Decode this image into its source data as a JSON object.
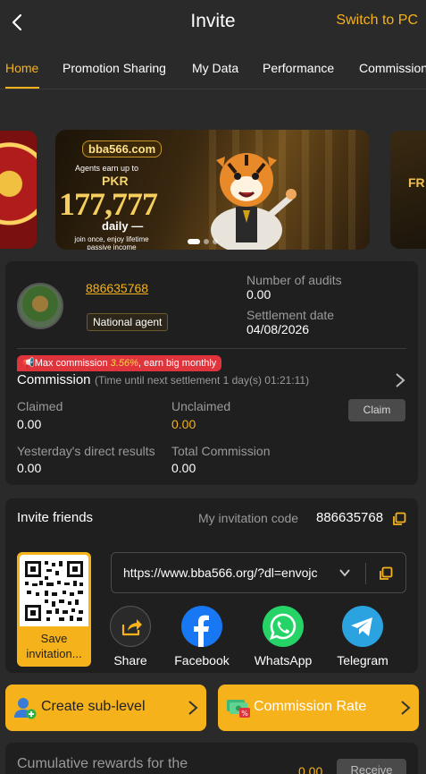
{
  "header": {
    "title": "Invite",
    "switch_label": "Switch to PC"
  },
  "tabs": [
    {
      "label": "Home",
      "active": true
    },
    {
      "label": "Promotion Sharing"
    },
    {
      "label": "My Data"
    },
    {
      "label": "Performance"
    },
    {
      "label": "Commission"
    }
  ],
  "banner": {
    "logo": "bba566.com",
    "subtitle": "Agents earn up to",
    "currency": "PKR",
    "amount": "177,777",
    "period": "daily —",
    "tagline": "join once, enjoy lifetime passive income",
    "right_peek": "FR"
  },
  "agent": {
    "user_id": "886635768",
    "badge": "National agent",
    "audits_label": "Number of audits",
    "audits_value": "0.00",
    "settlement_label": "Settlement date",
    "settlement_value": "04/08/2026"
  },
  "commission": {
    "promo_prefix": "Max commission ",
    "promo_pct": "3.56%",
    "promo_suffix": ", earn big monthly",
    "title": "Commission",
    "timer": "(Time until next settlement  1 day(s) 01:21:11)",
    "claimed_label": "Claimed",
    "claimed_value": "0.00",
    "unclaimed_label": "Unclaimed",
    "unclaimed_value": "0.00",
    "claim_button": "Claim",
    "yesterday_label": "Yesterday's direct results",
    "yesterday_value": "0.00",
    "total_label": "Total Commission",
    "total_value": "0.00"
  },
  "invite": {
    "title": "Invite friends",
    "code_label": "My invitation code",
    "code_value": "886635768",
    "save_label": "Save invitation...",
    "link": "https://www.bba566.org/?dl=envojc",
    "share": [
      {
        "label": "Share",
        "icon": "share-icon",
        "color": "#2a2a2a"
      },
      {
        "label": "Facebook",
        "icon": "facebook-icon",
        "color": "#1877f2"
      },
      {
        "label": "WhatsApp",
        "icon": "whatsapp-icon",
        "color": "#25d366"
      },
      {
        "label": "Telegram",
        "icon": "telegram-icon",
        "color": "#2aa3e0"
      }
    ]
  },
  "actions": {
    "create_sublevel": "Create sub-level",
    "commission_rate": "Commission Rate"
  },
  "rewards": {
    "label": "Cumulative rewards for the",
    "value": "0.00",
    "receive_button": "Receive"
  },
  "colors": {
    "accent": "#f6b21a",
    "background": "#2a2a2a",
    "card": "#1f1f1f",
    "promo": "#e0343c"
  }
}
